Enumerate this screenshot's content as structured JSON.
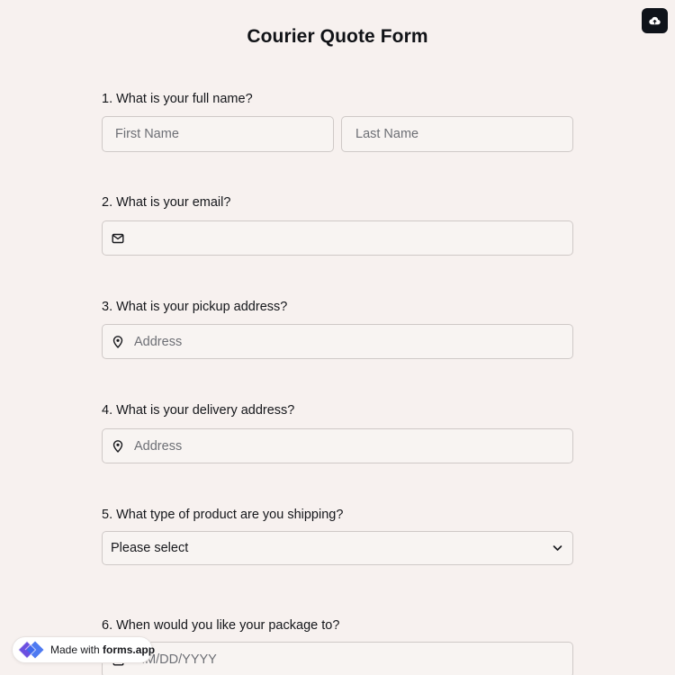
{
  "form": {
    "title": "Courier Quote Form"
  },
  "toolbar": {
    "cloud_icon": "cloud-upload-icon"
  },
  "questions": [
    {
      "label": "1.  What is your full name?",
      "first_placeholder": "First Name",
      "last_placeholder": "Last Name"
    },
    {
      "label": "2. What is your email?",
      "icon": "mail-icon",
      "placeholder": ""
    },
    {
      "label": "3. What is your pickup address?",
      "icon": "map-pin-icon",
      "placeholder": "Address"
    },
    {
      "label": "4. What is your delivery address?",
      "icon": "map-pin-icon",
      "placeholder": "Address"
    },
    {
      "label": "5. What type of product are you shipping?",
      "selected": "Please select",
      "icon": "chevron-down-icon"
    },
    {
      "label": "6. When would you like your package to?",
      "icon": "calendar-icon",
      "placeholder": "MM/DD/YYYY"
    }
  ],
  "badge": {
    "prefix": "Made with ",
    "brand": "forms.app",
    "logo": "forms-app-logo",
    "brand_colors": [
      "#6b4fe0",
      "#3b6bf0"
    ]
  }
}
